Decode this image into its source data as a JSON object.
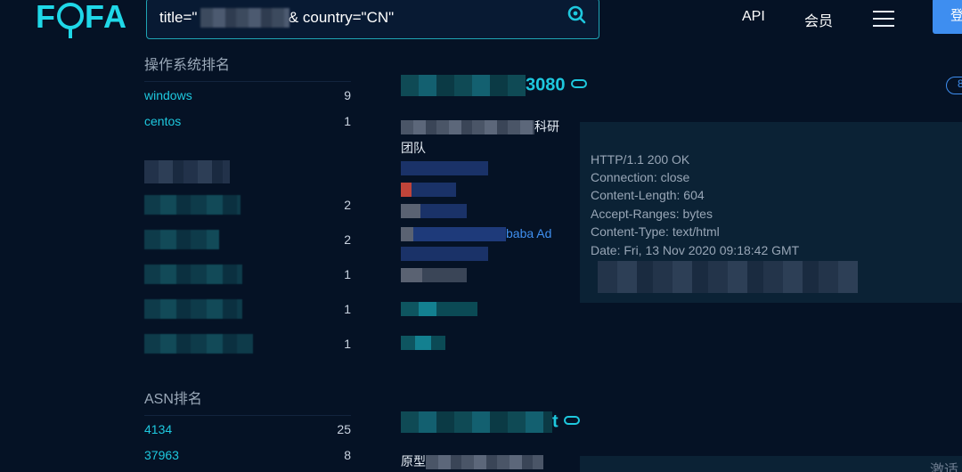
{
  "header": {
    "logo_prefix": "F",
    "logo_suffix": "FA",
    "search_query": "title=\"                 \" && country=\"CN\"",
    "nav_api": "API",
    "nav_member": "会员",
    "login_label": "登"
  },
  "sidebar": {
    "os_title": "操作系统排名",
    "os_items": [
      {
        "name": "windows",
        "count": "9"
      },
      {
        "name": "centos",
        "count": "1"
      }
    ],
    "blurred_counts": [
      "2",
      "2",
      "1",
      "1",
      "1"
    ],
    "asn_title": "ASN排名",
    "asn_items": [
      {
        "name": "4134",
        "count": "25"
      },
      {
        "name": "37963",
        "count": "8"
      }
    ]
  },
  "results": {
    "first": {
      "host_suffix": "3080",
      "desc_suffix": "科研",
      "desc_line2": "团队",
      "link_fragment": "baba Ad",
      "http_lines": [
        "HTTP/1.1 200 OK",
        "Connection: close",
        "Content-Length: 604",
        "Accept-Ranges: bytes",
        "Content-Type: text/html",
        "Date: Fri, 13 Nov 2020 09:18:42 GMT"
      ]
    },
    "second": {
      "host_suffix": "t",
      "desc_prefix": "原型",
      "corner_text": "激适"
    }
  },
  "colors": {
    "accent": "#1ec8de",
    "background": "#051225",
    "link": "#3f8ff0"
  }
}
